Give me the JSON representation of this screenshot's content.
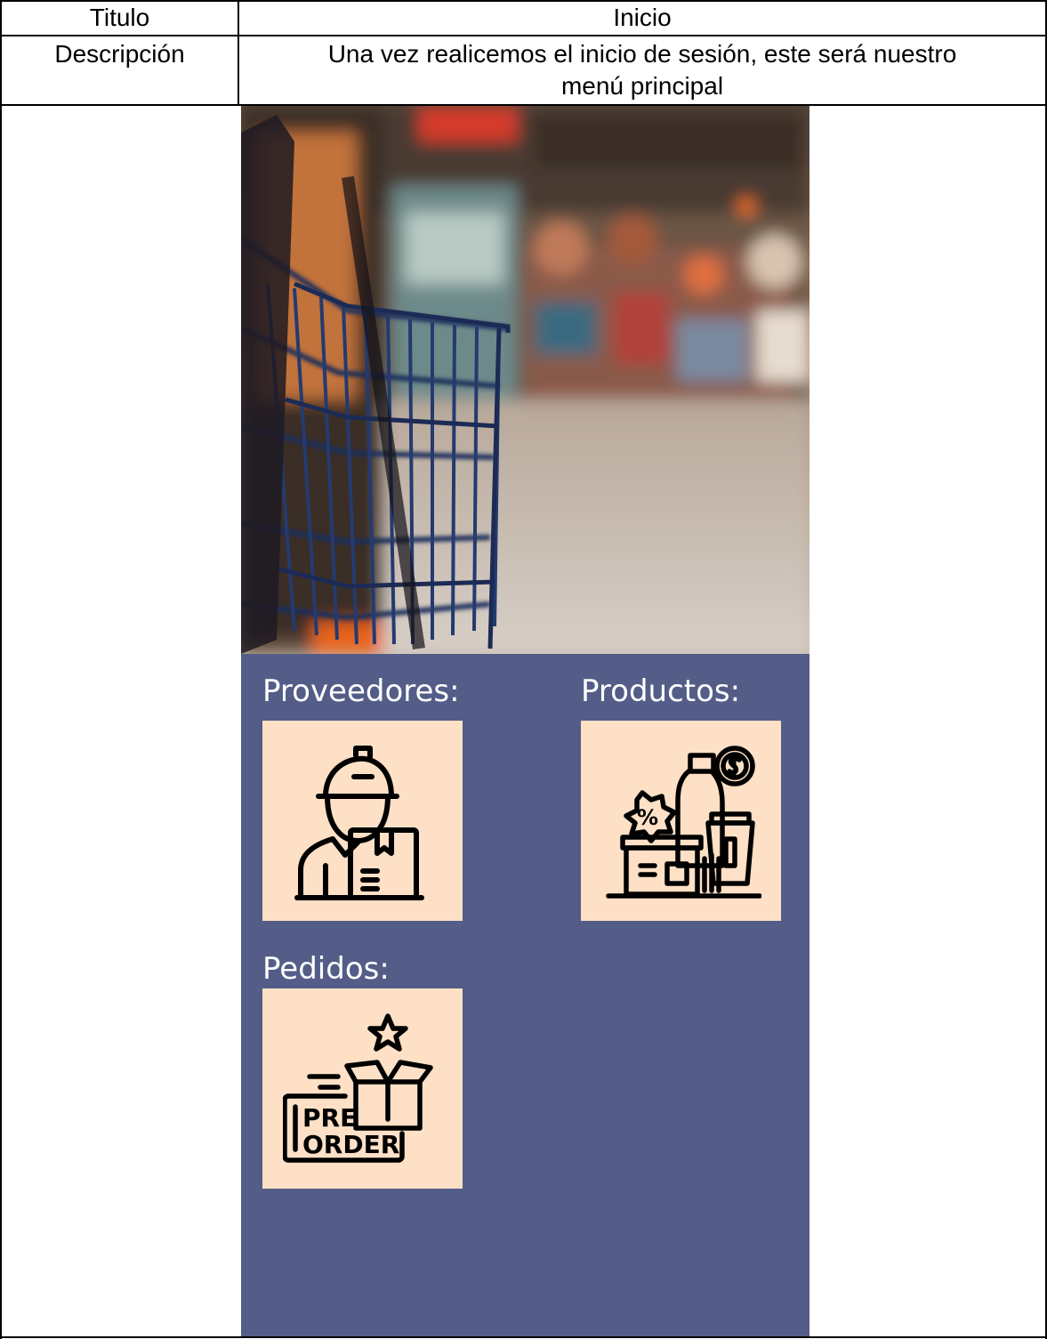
{
  "table": {
    "row1_label": "Titulo",
    "row1_value": "Inicio",
    "row2_label": "Descripción",
    "row2_value_line1": "Una vez realicemos el inicio de sesión, este será nuestro",
    "row2_value_line2": "menú principal"
  },
  "app": {
    "background_color": "#535d88",
    "tile_color": "#fde0c6",
    "hero_image": "supermarket-cart-photo",
    "sections": {
      "proveedores": {
        "label": "Proveedores:",
        "icon": "delivery-man-icon"
      },
      "productos": {
        "label": "Productos:",
        "icon": "products-discount-icon"
      },
      "pedidos": {
        "label": "Pedidos:",
        "icon": "pre-order-icon",
        "icon_text_1": "PRE",
        "icon_text_2": "ORDER"
      }
    }
  }
}
